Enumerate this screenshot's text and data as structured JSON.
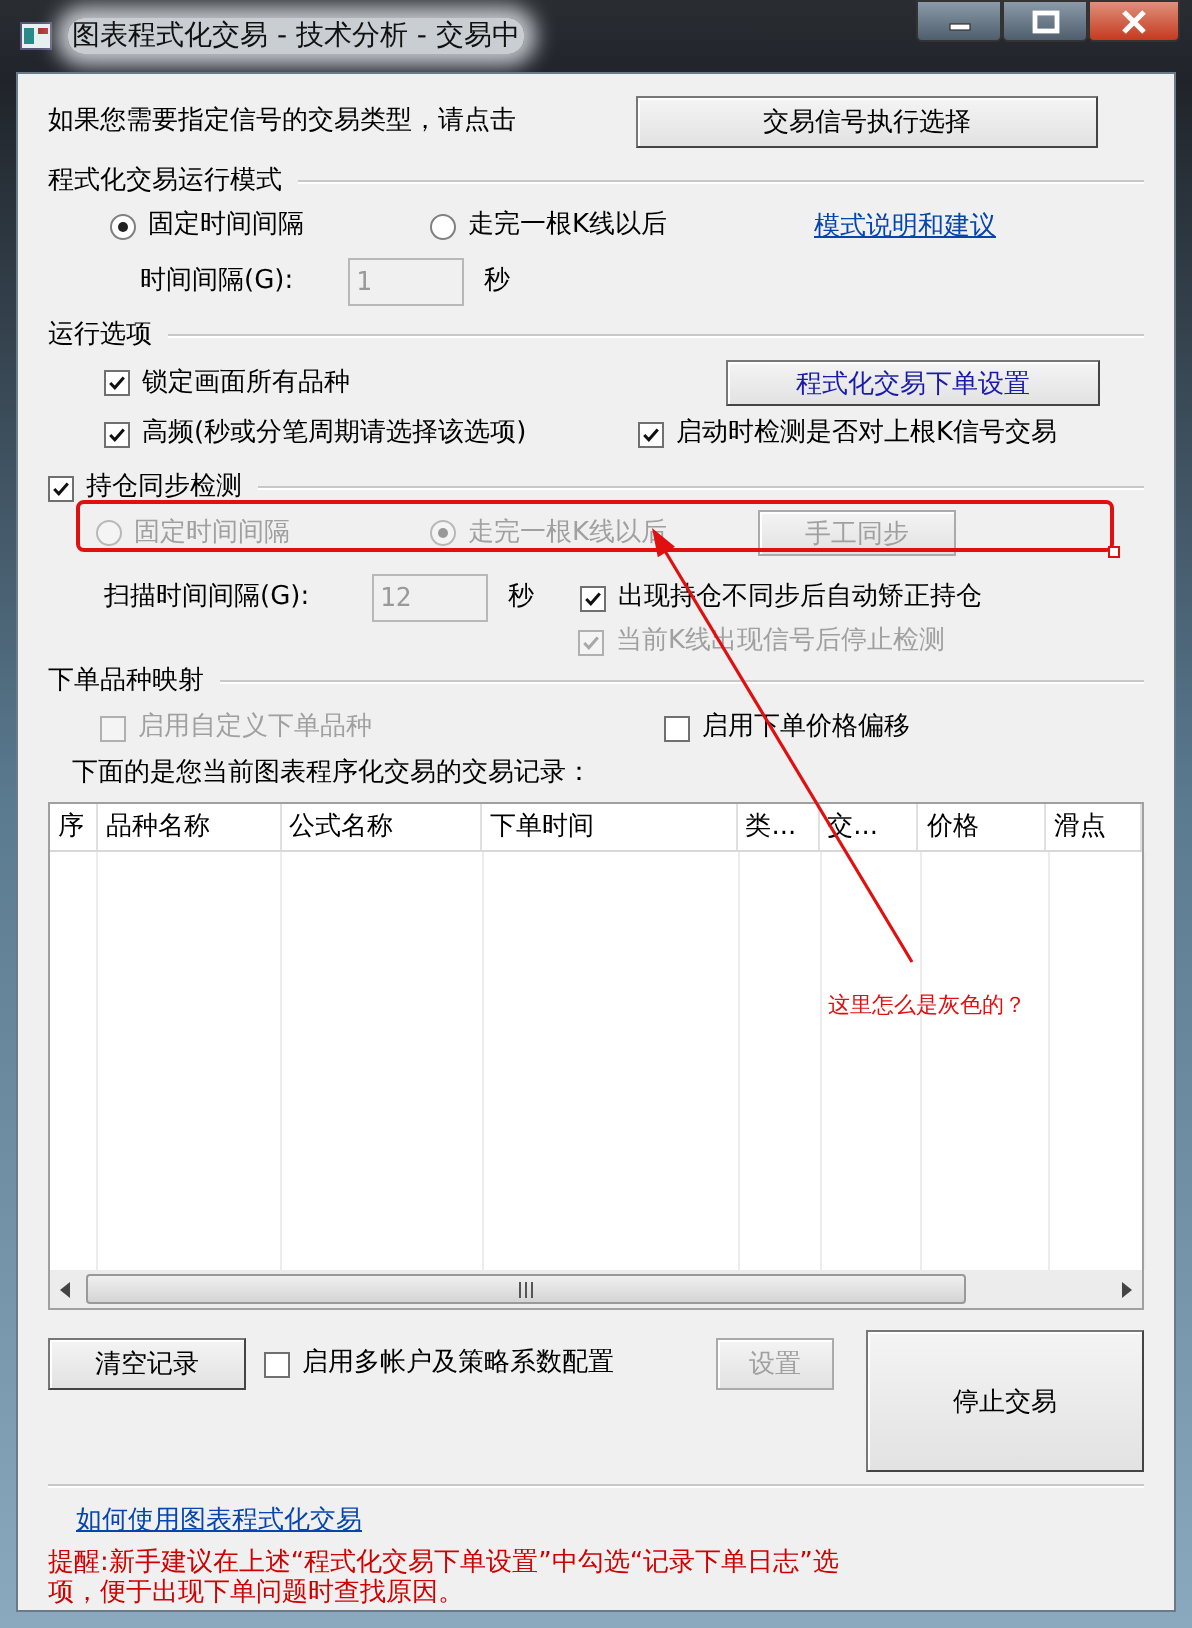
{
  "window": {
    "title": "图表程式化交易 - 技术分析 - 交易中"
  },
  "signal_prompt": {
    "text": "如果您需要指定信号的交易类型，请点击",
    "button": "交易信号执行选择"
  },
  "run_mode": {
    "heading": "程式化交易运行模式",
    "radios": [
      {
        "label": "固定时间间隔",
        "selected": true
      },
      {
        "label": "走完一根K线以后",
        "selected": false
      }
    ],
    "help_link": "模式说明和建议",
    "interval": {
      "label": "时间间隔(G):",
      "value": "1",
      "unit": "秒",
      "disabled": true
    }
  },
  "run_options": {
    "heading": "运行选项",
    "order_settings_button": "程式化交易下单设置",
    "checkboxes": [
      {
        "label": "锁定画面所有品种",
        "checked": true,
        "disabled": false
      },
      {
        "label": "高频(秒或分笔周期请选择该选项)",
        "checked": true,
        "disabled": false
      },
      {
        "label": "启动时检测是否对上根K信号交易",
        "checked": true,
        "disabled": false
      }
    ]
  },
  "position_sync": {
    "label": "持仓同步检测",
    "checked": true,
    "radios": [
      {
        "label": "固定时间间隔",
        "selected": false,
        "disabled": true
      },
      {
        "label": "走完一根K线以后",
        "selected": true,
        "disabled": true
      }
    ],
    "manual_sync_button": {
      "label": "手工同步",
      "disabled": true
    },
    "scan_interval": {
      "label": "扫描时间间隔(G):",
      "value": "12",
      "unit": "秒",
      "disabled": true
    },
    "checkboxes": [
      {
        "label": "出现持仓不同步后自动矫正持仓",
        "checked": true,
        "disabled": false
      },
      {
        "label": "当前K线出现信号后停止检测",
        "checked": true,
        "disabled": true
      }
    ]
  },
  "symbol_mapping": {
    "heading": "下单品种映射",
    "checkboxes": [
      {
        "label": "启用自定义下单品种",
        "checked": false,
        "disabled": true
      },
      {
        "label": "启用下单价格偏移",
        "checked": false,
        "disabled": false
      }
    ]
  },
  "records": {
    "caption": "下面的是您当前图表程序化交易的交易记录：",
    "columns": [
      "序",
      "品种名称",
      "公式名称",
      "下单时间",
      "类...",
      "交...",
      "价格",
      "滑点"
    ]
  },
  "actions": {
    "clear_button": "清空记录",
    "multi_account": {
      "label": "启用多帐户及策略系数配置",
      "checked": false
    },
    "settings_button": {
      "label": "设置",
      "disabled": true
    },
    "stop_button": "停止交易"
  },
  "help_link": "如何使用图表程式化交易",
  "reminder": "提醒:新手建议在上述“程式化交易下单设置”中勾选“记录下单日志”选项，便于出现下单问题时查找原因。",
  "annotation": {
    "text": "这里怎么是灰色的？"
  }
}
